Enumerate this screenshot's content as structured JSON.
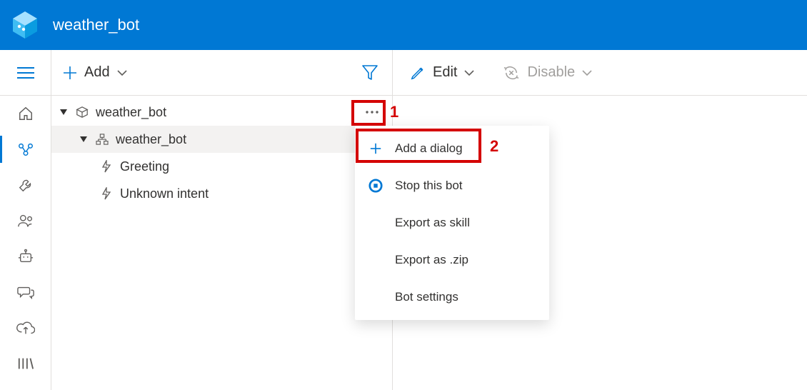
{
  "header": {
    "title": "weather_bot"
  },
  "leftpanel": {
    "add_label": "Add"
  },
  "tree": {
    "root": {
      "label": "weather_bot"
    },
    "sub": {
      "label": "weather_bot"
    },
    "greeting": {
      "label": "Greeting"
    },
    "unknown": {
      "label": "Unknown intent"
    }
  },
  "rp": {
    "edit_label": "Edit",
    "disable_label": "Disable"
  },
  "menu": {
    "add_dialog": "Add a dialog",
    "stop_bot": "Stop this bot",
    "export_skill": "Export as skill",
    "export_zip": "Export as .zip",
    "bot_settings": "Bot settings"
  },
  "annot": {
    "one": "1",
    "two": "2"
  }
}
